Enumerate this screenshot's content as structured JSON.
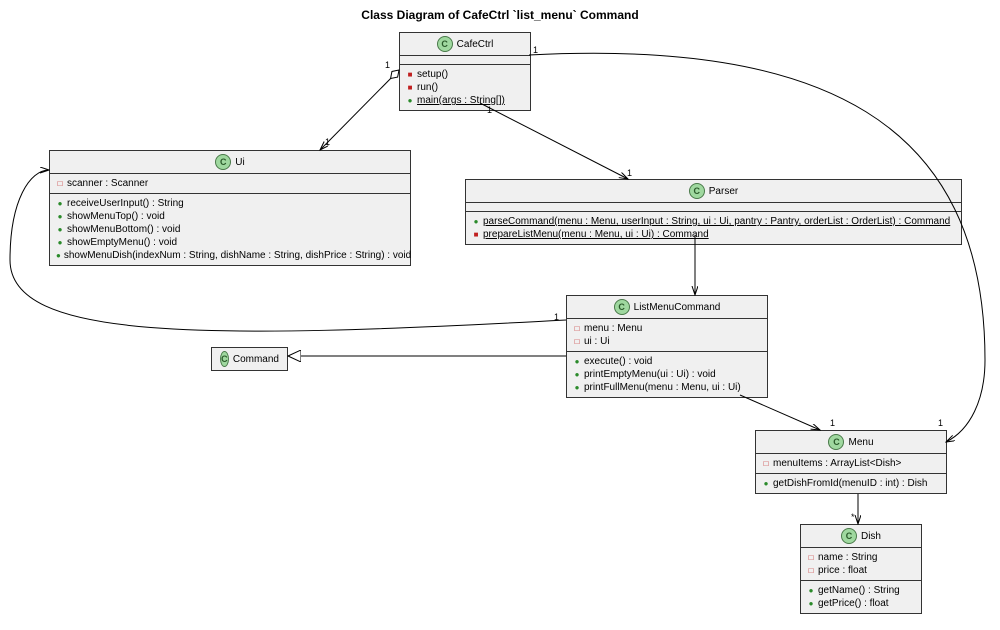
{
  "title": "Class Diagram of CafeCtrl `list_menu` Command",
  "classes": {
    "cafectrl": {
      "name": "CafeCtrl",
      "methods": [
        {
          "vis": "private",
          "label": "setup()"
        },
        {
          "vis": "private",
          "label": "run()"
        },
        {
          "vis": "public",
          "label": "main(args : String[])",
          "static": true
        }
      ]
    },
    "ui": {
      "name": "Ui",
      "fields": [
        {
          "vis": "protected",
          "label": "scanner : Scanner"
        }
      ],
      "methods": [
        {
          "vis": "public",
          "label": "receiveUserInput() : String"
        },
        {
          "vis": "public",
          "label": "showMenuTop() : void"
        },
        {
          "vis": "public",
          "label": "showMenuBottom() : void"
        },
        {
          "vis": "public",
          "label": "showEmptyMenu() : void"
        },
        {
          "vis": "public",
          "label": "showMenuDish(indexNum : String, dishName : String, dishPrice : String) : void"
        }
      ]
    },
    "parser": {
      "name": "Parser",
      "methods": [
        {
          "vis": "public",
          "label": "parseCommand(menu : Menu, userInput : String, ui : Ui, pantry : Pantry, orderList : OrderList) : Command",
          "static": true
        },
        {
          "vis": "private",
          "label": "prepareListMenu(menu : Menu, ui : Ui) : Command",
          "static": true
        }
      ]
    },
    "listmenu": {
      "name": "ListMenuCommand",
      "fields": [
        {
          "vis": "protected",
          "label": "menu : Menu"
        },
        {
          "vis": "protected",
          "label": "ui : Ui"
        }
      ],
      "methods": [
        {
          "vis": "public",
          "label": "execute() : void"
        },
        {
          "vis": "public",
          "label": "printEmptyMenu(ui : Ui) : void"
        },
        {
          "vis": "public",
          "label": "printFullMenu(menu : Menu, ui : Ui)"
        }
      ]
    },
    "command": {
      "name": "Command"
    },
    "menu": {
      "name": "Menu",
      "fields": [
        {
          "vis": "protected",
          "label": "menuItems : ArrayList<Dish>"
        }
      ],
      "methods": [
        {
          "vis": "public",
          "label": "getDishFromId(menuID : int) : Dish"
        }
      ]
    },
    "dish": {
      "name": "Dish",
      "fields": [
        {
          "vis": "protected",
          "label": "name : String"
        },
        {
          "vis": "protected",
          "label": "price : float"
        }
      ],
      "methods": [
        {
          "vis": "public",
          "label": "getName() : String"
        },
        {
          "vis": "public",
          "label": "getPrice() : float"
        }
      ]
    }
  },
  "mult": {
    "c_ui_a": "1",
    "c_ui_b": "1",
    "c_parser_a": "1",
    "c_parser_b": "1",
    "c_menu_a": "1",
    "c_menu_b": "1",
    "lm_ui": "1",
    "lm_menu": "1",
    "menu_dish": "*"
  }
}
